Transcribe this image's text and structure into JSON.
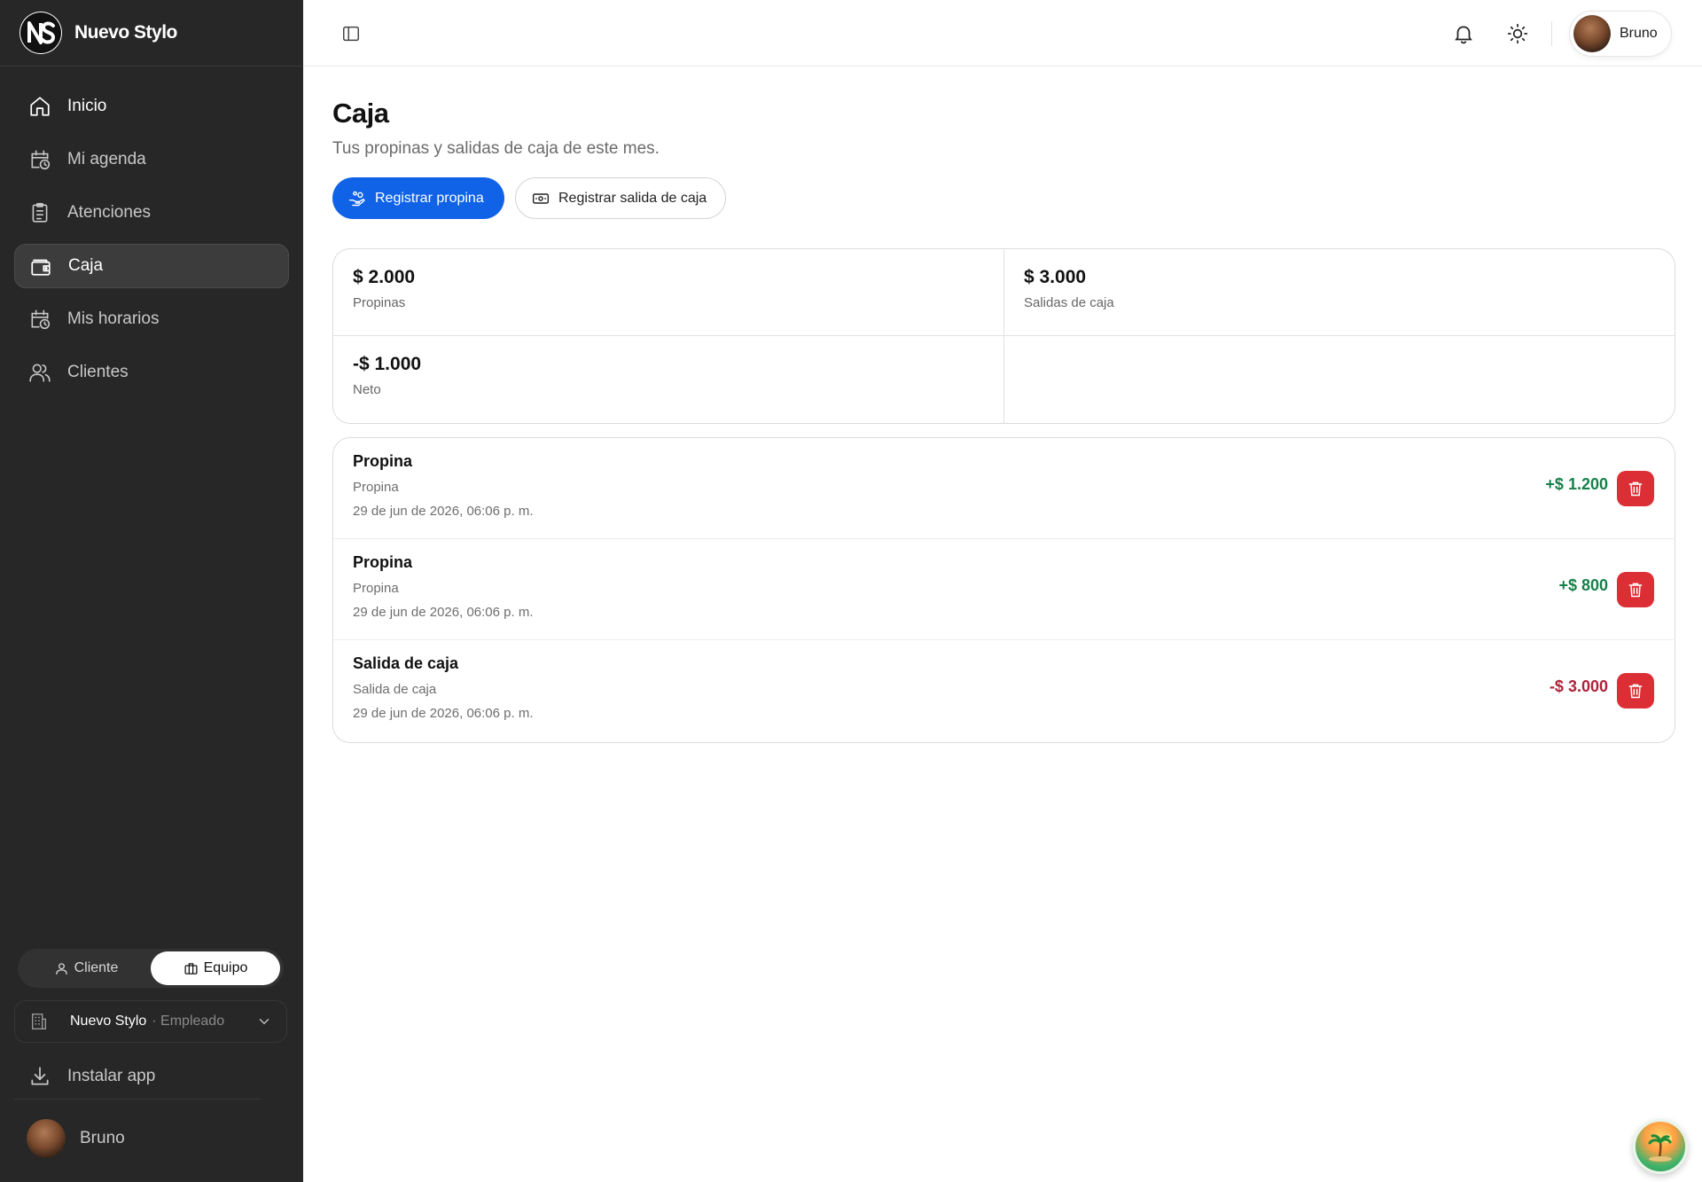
{
  "brand": {
    "name": "Nuevo Stylo",
    "logo_icon": "ns-logo-icon"
  },
  "sidebar": {
    "items": [
      {
        "label": "Inicio",
        "icon": "home-icon"
      },
      {
        "label": "Mi agenda",
        "icon": "calendar-clock-icon"
      },
      {
        "label": "Atenciones",
        "icon": "clipboard-list-icon"
      },
      {
        "label": "Caja",
        "icon": "wallet-icon",
        "active": true
      },
      {
        "label": "Mis horarios",
        "icon": "calendar-clock-icon"
      },
      {
        "label": "Clientes",
        "icon": "users-icon"
      }
    ],
    "mode_toggle": {
      "client_label": "Cliente",
      "team_label": "Equipo",
      "selected": "Equipo"
    },
    "company": {
      "name": "Nuevo Stylo",
      "role": "· Empleado"
    },
    "install_label": "Instalar app",
    "user_name": "Bruno"
  },
  "topbar": {
    "user_name": "Bruno"
  },
  "page": {
    "title": "Caja",
    "subtitle": "Tus propinas y salidas de caja de este mes.",
    "actions": {
      "tip_label": "Registrar propina",
      "withdraw_label": "Registrar salida de caja"
    }
  },
  "stats": [
    {
      "value": "$ 2.000",
      "label": "Propinas"
    },
    {
      "value": "$ 3.000",
      "label": "Salidas de caja"
    },
    {
      "value": "-$ 1.000",
      "label": "Neto"
    }
  ],
  "transactions": [
    {
      "title": "Propina",
      "type": "Propina",
      "date": "29 de jun de 2026, 06:06 p. m.",
      "amount": "+$ 1.200",
      "kind": "positive"
    },
    {
      "title": "Propina",
      "type": "Propina",
      "date": "29 de jun de 2026, 06:06 p. m.",
      "amount": "+$ 800",
      "kind": "positive"
    },
    {
      "title": "Salida de caja",
      "type": "Salida de caja",
      "date": "29 de jun de 2026, 06:06 p. m.",
      "amount": "-$ 3.000",
      "kind": "negative"
    }
  ],
  "colors": {
    "sidebar_bg": "#272727",
    "primary": "#1063e6",
    "positive": "#16804a",
    "negative": "#b0223a",
    "danger": "#dc2f35"
  }
}
